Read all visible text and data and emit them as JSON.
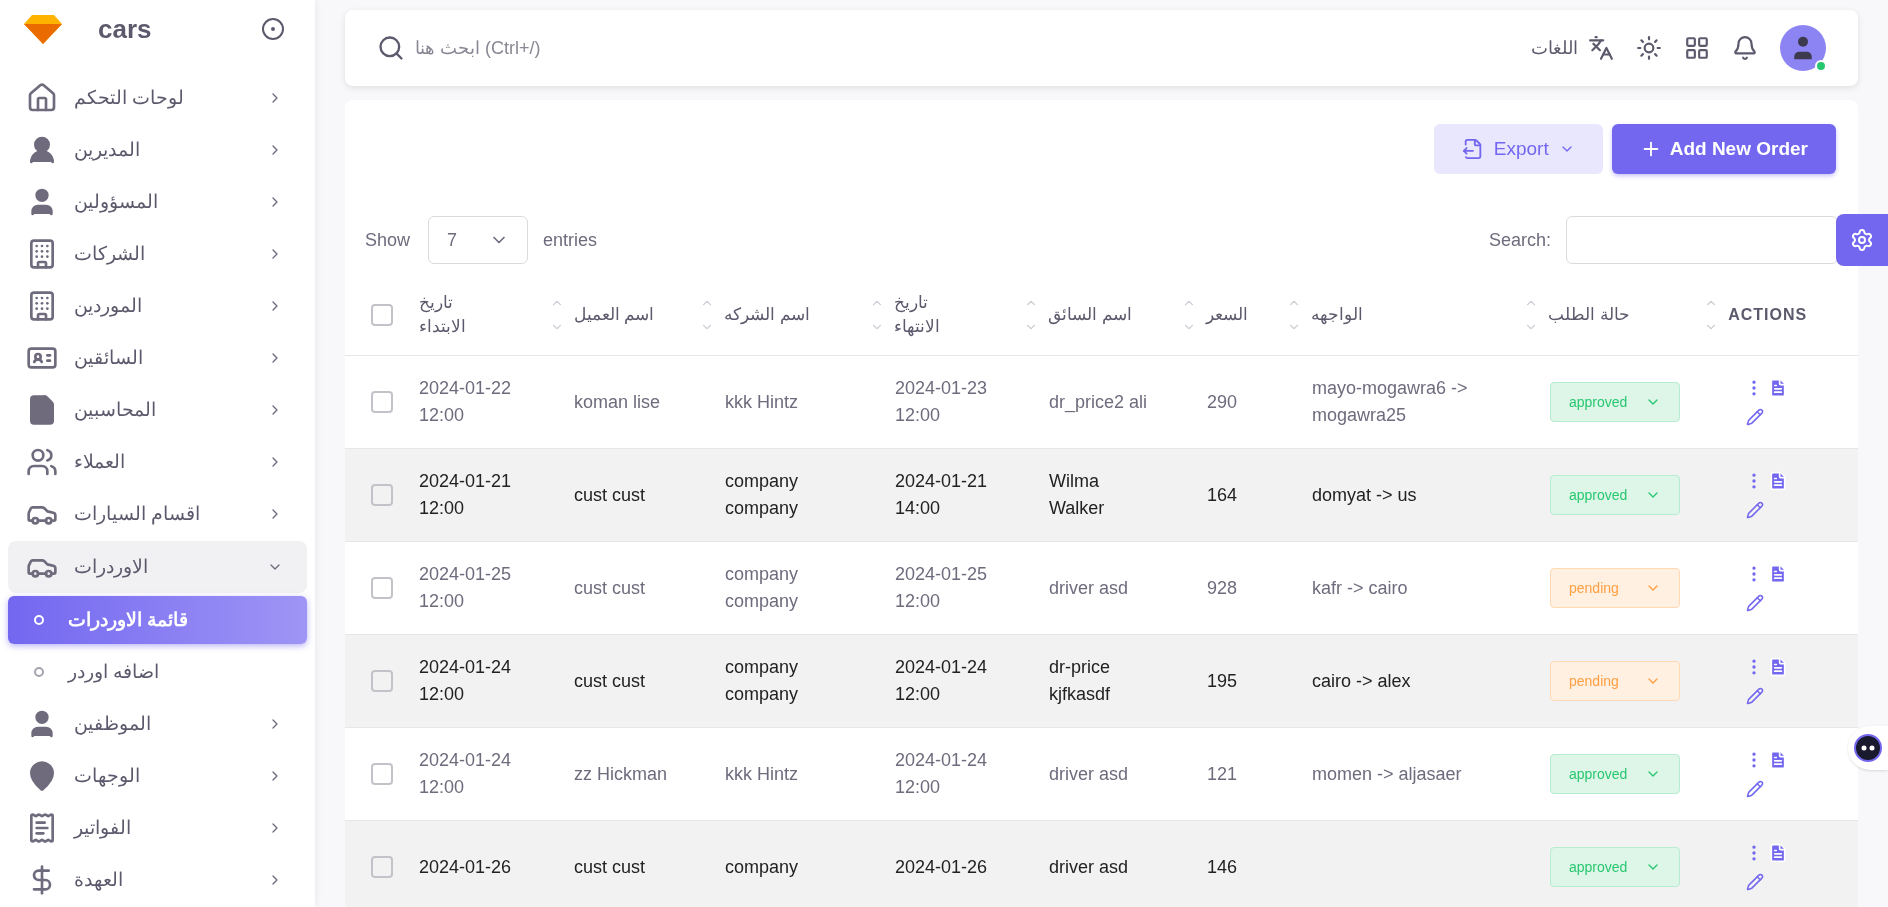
{
  "brand": {
    "name": "cars"
  },
  "sidebar": {
    "items": [
      {
        "label": "لوحات التحكم",
        "expanded": false
      },
      {
        "label": "المديرين",
        "expanded": false
      },
      {
        "label": "المسؤولين",
        "expanded": false
      },
      {
        "label": "الشركات",
        "expanded": false
      },
      {
        "label": "الموردين",
        "expanded": false
      },
      {
        "label": "السائقين",
        "expanded": false
      },
      {
        "label": "المحاسبين",
        "expanded": false
      },
      {
        "label": "العملاء",
        "expanded": false
      },
      {
        "label": "اقسام السيارات",
        "expanded": false
      },
      {
        "label": "الاوردرات",
        "expanded": true,
        "children": [
          {
            "label": "قائمة الاوردرات",
            "selected": true
          },
          {
            "label": "اضافه اوردر",
            "selected": false
          }
        ]
      },
      {
        "label": "الموظفين",
        "expanded": false
      },
      {
        "label": "الوجهات",
        "expanded": false
      },
      {
        "label": "الفواتير",
        "expanded": false
      },
      {
        "label": "العهدة",
        "expanded": false
      }
    ]
  },
  "topbar": {
    "search_placeholder": "ابحث هنا (Ctrl+/)",
    "language": "اللغات"
  },
  "toolbar": {
    "export": "Export",
    "add": "Add New Order"
  },
  "table_controls": {
    "show": "Show",
    "page_size": "7",
    "entries": "entries",
    "search": "Search:"
  },
  "table": {
    "select_all_checked": false,
    "columns": [
      "تاريخ\nالابتداء",
      "اسم العميل",
      "اسم الشركه",
      "تاريخ\nالانتهاء",
      "اسم السائق",
      "السعر",
      "الواجهه",
      "حالة الطلب",
      "ACTIONS"
    ],
    "rows": [
      {
        "checked": false,
        "cells": [
          "2024-01-22\n12:00",
          "koman lise",
          "kkk Hintz",
          "2024-01-23\n12:00",
          "dr_price2 ali",
          "290",
          "mayo-mogawra6 ->\nmogawra25"
        ],
        "status": {
          "label": "approved",
          "kind": "approved"
        }
      },
      {
        "checked": false,
        "cells": [
          "2024-01-21\n12:00",
          "cust cust",
          "company\ncompany",
          "2024-01-21\n14:00",
          "Wilma\nWalker",
          "164",
          "domyat -> us"
        ],
        "status": {
          "label": "approved",
          "kind": "approved"
        }
      },
      {
        "checked": false,
        "cells": [
          "2024-01-25\n12:00",
          "cust cust",
          "company\ncompany",
          "2024-01-25\n12:00",
          "driver asd",
          "928",
          "kafr -> cairo"
        ],
        "status": {
          "label": "pending",
          "kind": "pending"
        }
      },
      {
        "checked": false,
        "cells": [
          "2024-01-24\n12:00",
          "cust cust",
          "company\ncompany",
          "2024-01-24\n12:00",
          "dr-price\nkjfkasdf",
          "195",
          "cairo -> alex"
        ],
        "status": {
          "label": "pending",
          "kind": "pending"
        }
      },
      {
        "checked": false,
        "cells": [
          "2024-01-24\n12:00",
          "zz Hickman",
          "kkk Hintz",
          "2024-01-24\n12:00",
          "driver asd",
          "121",
          "momen -> aljasaer"
        ],
        "status": {
          "label": "approved",
          "kind": "approved"
        }
      },
      {
        "checked": false,
        "cells": [
          "2024-01-26",
          "cust cust",
          "company",
          "2024-01-26",
          "driver asd",
          "146"
        ],
        "status": {
          "label": "approved",
          "kind": "approved"
        }
      }
    ]
  }
}
